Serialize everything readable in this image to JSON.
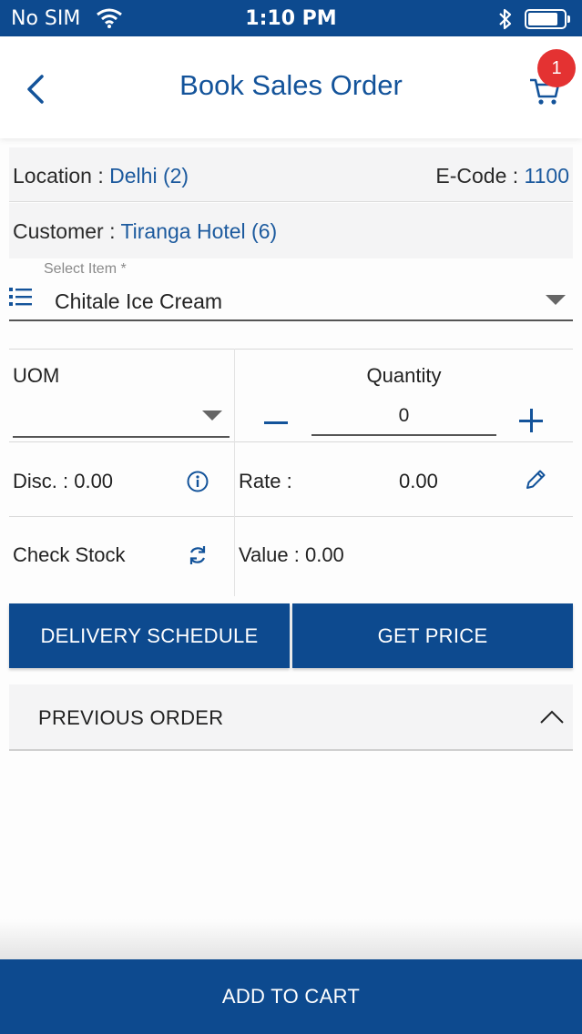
{
  "status_bar": {
    "carrier": "No SIM",
    "time": "1:10 PM",
    "icons": [
      "wifi-icon",
      "bluetooth-icon",
      "battery-icon"
    ]
  },
  "header": {
    "title": "Book Sales Order",
    "back_icon": "chevron-left-icon",
    "cart_icon": "cart-icon",
    "cart_badge": "1",
    "badge_color": "#e43232"
  },
  "info": {
    "location_label": "Location : ",
    "location_value": "Delhi (2)",
    "ecode_label": "E-Code : ",
    "ecode_value": "1100",
    "customer_label": "Customer : ",
    "customer_value": "Tiranga Hotel (6)"
  },
  "select_item": {
    "label": "Select Item *",
    "value": "Chitale Ice Cream",
    "icon": "list-icon"
  },
  "form": {
    "uom_label": "UOM",
    "uom_value": "",
    "quantity_label": "Quantity",
    "quantity_value": "0",
    "disc_text": "Disc. : 0.00",
    "rate_label": "Rate :",
    "rate_value": "0.00",
    "check_stock": "Check Stock",
    "value_text": "Value : 0.00"
  },
  "buttons": {
    "delivery_schedule": "DELIVERY SCHEDULE",
    "get_price": "GET PRICE",
    "previous_order": "PREVIOUS ORDER",
    "add_to_cart": "ADD TO CART"
  },
  "colors": {
    "primary": "#0d4a8f",
    "accent_text": "#1c5a9e",
    "row_background": "#f4f4f5"
  }
}
